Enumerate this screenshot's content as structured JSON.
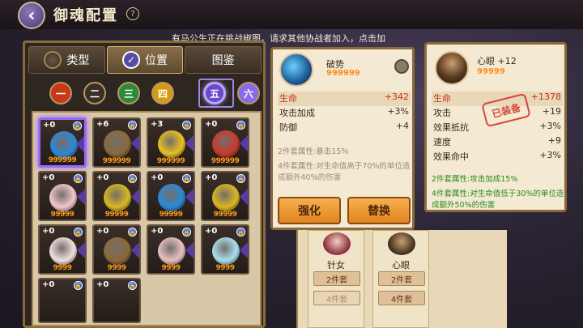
{
  "header": {
    "title": "御魂配置",
    "back_icon": "back-arrow-icon",
    "help_icon": "help-icon"
  },
  "notice": "有马公生正在挑战椒图，请求其他协战者加入，点击加",
  "tabs": [
    {
      "label": "类型",
      "icon": "type-icon"
    },
    {
      "label": "位置",
      "icon": "check-icon"
    },
    {
      "label": "图鉴",
      "icon": ""
    }
  ],
  "slots": [
    {
      "label": "一",
      "color": "#c8381a"
    },
    {
      "label": "二",
      "color": "#3a2e28"
    },
    {
      "label": "三",
      "color": "#2a8a3a"
    },
    {
      "label": "四",
      "color": "#d89818"
    },
    {
      "label": "五",
      "color": "#6a4ac8"
    },
    {
      "label": "六",
      "color": "#8a6ae8"
    }
  ],
  "cards": [
    {
      "level": "+0",
      "stars": "999999",
      "color": "#2a88d8"
    },
    {
      "level": "+6",
      "stars": "999999",
      "color": "#8a6a3a"
    },
    {
      "level": "+3",
      "stars": "999999",
      "color": "#e8c020"
    },
    {
      "level": "+0",
      "stars": "999999",
      "color": "#c83a2a"
    },
    {
      "level": "+0",
      "stars": "99999",
      "color": "#f0c8c8"
    },
    {
      "level": "+0",
      "stars": "99999",
      "color": "#d8b820"
    },
    {
      "level": "+0",
      "stars": "99999",
      "color": "#2a88d8"
    },
    {
      "level": "+0",
      "stars": "99999",
      "color": "#d8b820"
    },
    {
      "level": "+0",
      "stars": "9999",
      "color": "#f0e0e0"
    },
    {
      "level": "+0",
      "stars": "9999",
      "color": "#8a6a3a"
    },
    {
      "level": "+0",
      "stars": "9999",
      "color": "#e8c0c0"
    },
    {
      "level": "+0",
      "stars": "9999",
      "color": "#a8e0f0"
    },
    {
      "level": "+0",
      "stars": "",
      "color": "#3a2e28"
    },
    {
      "level": "+0",
      "stars": "",
      "color": "#3a2e28"
    }
  ],
  "mid_card": {
    "name": "破势",
    "stars": "999999",
    "main_stat": {
      "label": "生命",
      "value": "+342"
    },
    "stats": [
      {
        "label": "攻击加成",
        "value": "+3%"
      },
      {
        "label": "防御",
        "value": "+4"
      }
    ],
    "set2": "2件套属性:暴击15%",
    "set4": "4件套属性:对生命值高于70%的单位造成额外40%的伤害",
    "btn_upgrade": "强化",
    "btn_replace": "替换"
  },
  "right_card": {
    "name": "心眼 +12",
    "stars": "99999",
    "stamp": "已装备",
    "main_stat": {
      "label": "生命",
      "value": "+1378"
    },
    "stats": [
      {
        "label": "攻击",
        "value": "+19"
      },
      {
        "label": "效果抵抗",
        "value": "+3%"
      },
      {
        "label": "速度",
        "value": "+9"
      },
      {
        "label": "效果命中",
        "value": "+3%"
      }
    ],
    "set2": "2件套属性:攻击加成15%",
    "set4": "4件套属性:对生命值低于30%的单位造成额外50%的伤害"
  },
  "team": [
    {
      "name": "针女",
      "btn1": "2件套",
      "btn2": "4件套"
    },
    {
      "name": "心眼",
      "btn1": "2件套",
      "btn2": "4件套"
    }
  ]
}
